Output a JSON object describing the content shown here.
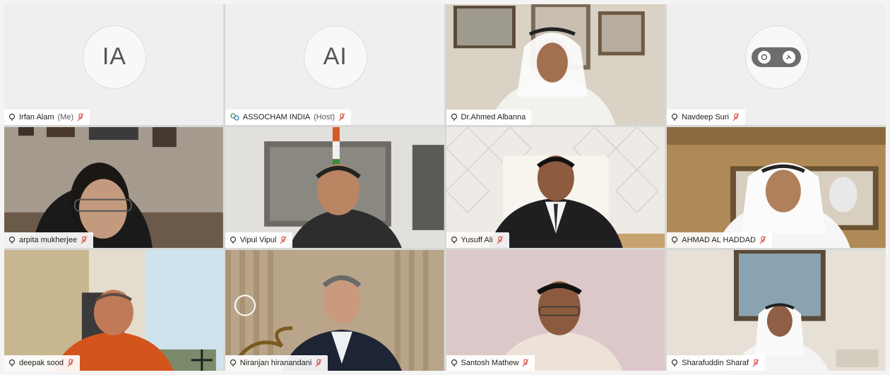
{
  "participants": [
    {
      "name": "Irfan Alam",
      "suffix": "(Me)",
      "initials": "IA"
    },
    {
      "name": "ASSOCHAM INDIA",
      "suffix": "(Host)",
      "initials": "AI"
    },
    {
      "name": "Dr.Ahmed Albanna",
      "suffix": ""
    },
    {
      "name": "Navdeep Suri",
      "suffix": ""
    },
    {
      "name": "arpita mukherjee",
      "suffix": ""
    },
    {
      "name": "Vipul Vipul",
      "suffix": ""
    },
    {
      "name": "Yusuff Ali",
      "suffix": ""
    },
    {
      "name": "AHMAD AL HADDAD",
      "suffix": ""
    },
    {
      "name": "deepak sood",
      "suffix": ""
    },
    {
      "name": "Niranjan hiranandani",
      "suffix": ""
    },
    {
      "name": "Santosh Mathew",
      "suffix": ""
    },
    {
      "name": "Sharafuddin Sharaf",
      "suffix": ""
    }
  ],
  "colors": {
    "active_speaker_border": "#3bb3d8",
    "muted_icon": "#d9534f"
  }
}
